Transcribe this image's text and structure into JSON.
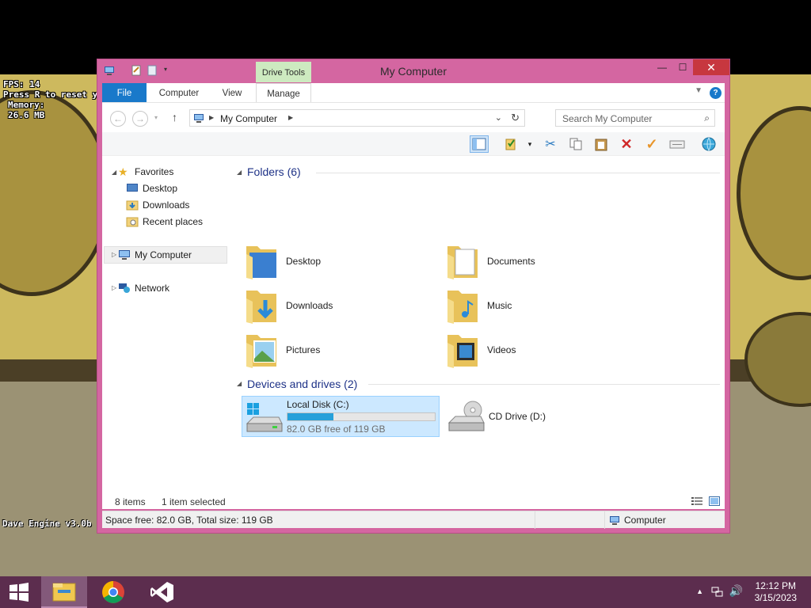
{
  "overlay": {
    "fps": "FPS: 14",
    "reset_hint": "Press R to reset y",
    "memory_label": "Memory:",
    "memory_value": "26.6 MB",
    "engine": "Dave Engine v3.0b"
  },
  "window": {
    "title": "My Computer",
    "context_tab": "Drive Tools",
    "close_glyph": "✕",
    "minimize_glyph": "—",
    "maximize_glyph": "☐"
  },
  "ribbon": {
    "tabs": [
      "File",
      "Computer",
      "View",
      "Manage"
    ],
    "help_glyph": "?"
  },
  "address": {
    "crumb": "My Computer",
    "search_placeholder": "Search My Computer"
  },
  "nav": {
    "favorites": "Favorites",
    "desktop": "Desktop",
    "downloads": "Downloads",
    "recent": "Recent places",
    "mycomputer": "My Computer",
    "network": "Network"
  },
  "folders": {
    "heading": "Folders (6)",
    "items": [
      "Desktop",
      "Documents",
      "Downloads",
      "Music",
      "Pictures",
      "Videos"
    ]
  },
  "drives": {
    "heading": "Devices and drives (2)",
    "local": {
      "name": "Local Disk (C:)",
      "free_text": "82.0 GB free of 119 GB",
      "used_fraction": 0.31
    },
    "cd": {
      "name": "CD Drive (D:)"
    }
  },
  "status": {
    "items": "8 items",
    "selected": "1 item selected",
    "space": "Space free: 82.0 GB, Total size: 119 GB",
    "location": "Computer"
  },
  "taskbar": {
    "time": "12:12 PM",
    "date": "3/15/2023"
  },
  "colors": {
    "window_frame": "#d466a1",
    "accent": "#1979ca",
    "taskbar": "#5c2d4e",
    "drive_fill": "#26a0da"
  }
}
